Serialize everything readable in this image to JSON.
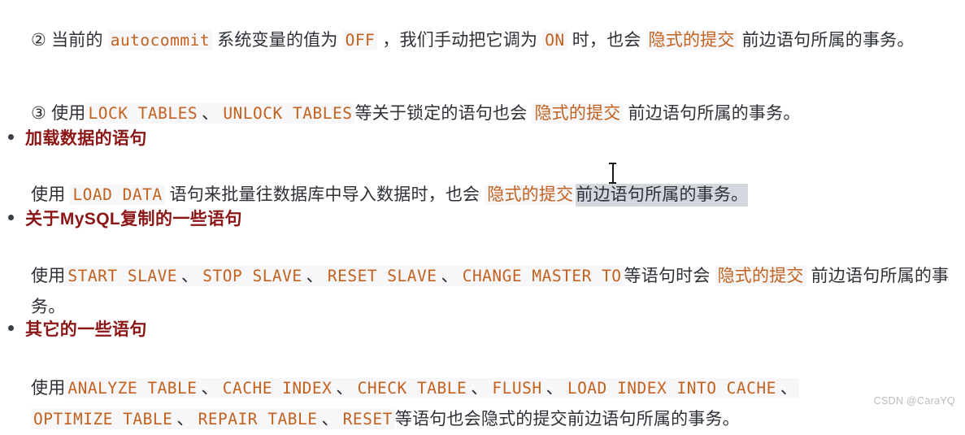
{
  "document": {
    "watermark": "CSDN @CaraYQ",
    "accent_code_color": "#c3611f",
    "heading_color": "#8c1515",
    "body_color": "#2d3136",
    "code_bg_color": "#f7f7f9",
    "selection_bg_color": "#d3d7de"
  },
  "paragraphs": {
    "item2": {
      "marker": "②",
      "seg1": " 当前的 ",
      "code1": "autocommit",
      "seg2": " 系统变量的值为 ",
      "code2": "OFF",
      "seg3": " ，我们手动把它调为 ",
      "code3": "ON",
      "seg4": " 时，也会 ",
      "hl1": "隐式的提交",
      "seg5": " 前边语句所属的事务。"
    },
    "item3": {
      "marker": "③",
      "seg1": " 使用",
      "code1": "LOCK TABLES",
      "sep1": "、",
      "code2": "UNLOCK TABLES",
      "seg2": "等关于锁定的语句也会 ",
      "hl1": "隐式的提交",
      "seg3": " 前边语句所属的事务。"
    },
    "load": {
      "seg1": "使用 ",
      "code1": "LOAD DATA",
      "seg2": " 语句来批量往数据库中导入数据时，也会 ",
      "hl1": "隐式的提交",
      "selected": "前边语句所属的事务。"
    },
    "replication": {
      "seg1": "使用",
      "code1": "START SLAVE",
      "sep1": "、",
      "code2": "STOP SLAVE",
      "sep2": "、",
      "code3": "RESET SLAVE",
      "sep3": "、",
      "code4": "CHANGE MASTER TO",
      "seg2": "等语句时会 ",
      "hl1": "隐式的提交",
      "seg3": " 前边语句所属的事务。"
    },
    "other": {
      "seg1": "使用",
      "code1": "ANALYZE TABLE",
      "sep1": "、",
      "code2": "CACHE INDEX",
      "sep2": "、",
      "code3": "CHECK TABLE",
      "sep3": "、",
      "code4": "FLUSH",
      "sep4": "、",
      "code5": "LOAD INDEX INTO CACHE",
      "sep5": "、",
      "code6": "OPTIMIZE TABLE",
      "sep6": "、",
      "code7": "REPAIR TABLE",
      "sep7": "、",
      "code8": "RESET",
      "seg2": "等语句也会隐式的提交前边语句所属的事务。"
    }
  },
  "headings": [
    {
      "text": "加载数据的语句"
    },
    {
      "text_pre": "关于",
      "text_latin": "MySQL",
      "text_post": "复制的一些语句"
    },
    {
      "text": "其它的一些语句"
    }
  ]
}
